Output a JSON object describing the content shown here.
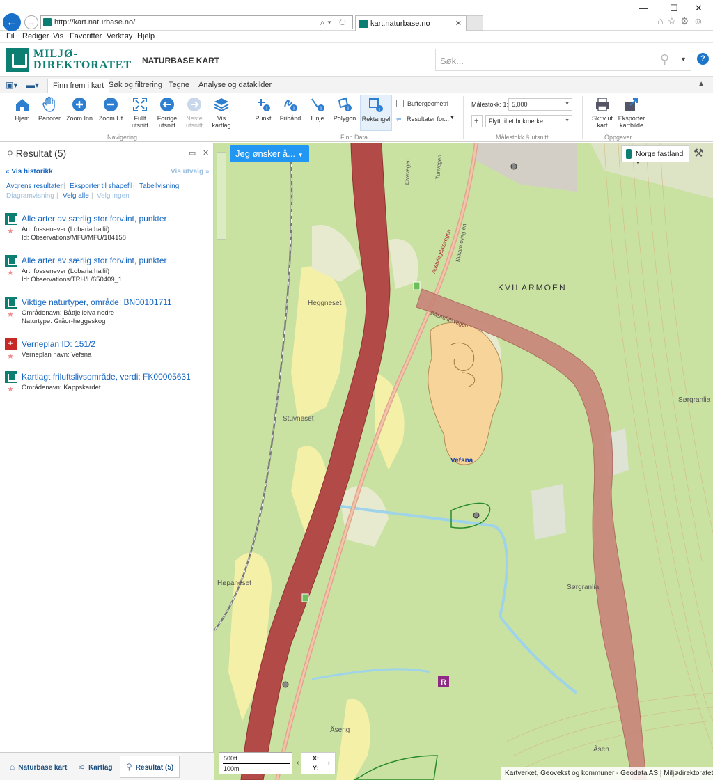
{
  "browser": {
    "url": "http://kart.naturbase.no/",
    "tab_title": "kart.naturbase.no",
    "menu": [
      "Fil",
      "Rediger",
      "Vis",
      "Favoritter",
      "Verktøy",
      "Hjelp"
    ],
    "window_controls": [
      "—",
      "☐",
      "✕"
    ]
  },
  "header": {
    "logo_line1": "MILJØ-",
    "logo_line2": "DIREKTORATET",
    "app_title": "NATURBASE KART",
    "search_placeholder": "Søk...",
    "help": "?"
  },
  "ribbon_tabs": [
    "Finn frem i kart",
    "Søk og filtrering",
    "Tegne",
    "Analyse og datakilder"
  ],
  "ribbon": {
    "nav_buttons": [
      {
        "label": "Hjem",
        "icon": "home-icon"
      },
      {
        "label": "Panorer",
        "icon": "hand-icon"
      },
      {
        "label": "Zoom Inn",
        "icon": "zoom-in-icon"
      },
      {
        "label": "Zoom Ut",
        "icon": "zoom-out-icon"
      },
      {
        "label": "Fullt utsnitt",
        "icon": "full-extent-icon"
      },
      {
        "label": "Forrige utsnitt",
        "icon": "previous-extent-icon"
      },
      {
        "label": "Neste utsnitt",
        "icon": "next-extent-icon"
      },
      {
        "label": "Vis kartlag",
        "icon": "layers-icon"
      }
    ],
    "nav_group": "Navigering",
    "data_buttons": [
      {
        "label": "Punkt",
        "icon": "point-info-icon"
      },
      {
        "label": "Frihånd",
        "icon": "freehand-info-icon"
      },
      {
        "label": "Linje",
        "icon": "line-info-icon"
      },
      {
        "label": "Polygon",
        "icon": "polygon-info-icon"
      },
      {
        "label": "Rektangel",
        "icon": "rectangle-info-icon"
      }
    ],
    "data_group": "Finn Data",
    "buffer_label": "Buffergeometri",
    "results_for": "Resultater for...",
    "scale_label": "Målestokk: 1:",
    "scale_value": "5,000",
    "bookmark_placeholder": "Flytt til et bokmerke",
    "scale_group": "Målestokk & utsnitt",
    "task_buttons": [
      {
        "label": "Skriv ut kart",
        "icon": "print-icon"
      },
      {
        "label": "Eksporter kartbilde",
        "icon": "export-icon"
      }
    ],
    "task_group": "Oppgaver"
  },
  "panel": {
    "title": "Resultat (5)",
    "vis_historikk": "Vis historikk",
    "vis_utvalg": "Vis utvalg",
    "actions": [
      "Avgrens resultater",
      "Eksporter til shapefil",
      "Tabellvisning"
    ],
    "diagram": "Diagramvisning",
    "velg_alle": "Velg alle",
    "velg_ingen": "Velg ingen",
    "results": [
      {
        "title": "Alle arter av særlig stor forv.int, punkter",
        "l1": "Art: fossenever (Lobaria hallii)",
        "l2": "Id: Observations/MFU/MFU/184158",
        "type": "naturbase"
      },
      {
        "title": "Alle arter av særlig stor forv.int, punkter",
        "l1": "Art: fossenever (Lobaria hallii)",
        "l2": "Id: Observations/TRH/L/650409_1",
        "type": "naturbase"
      },
      {
        "title": "Viktige naturtyper, område: BN00101711",
        "l1": "Områdenavn: Båtfjellelva nedre",
        "l2": "Naturtype: Gråor-heggeskog",
        "type": "naturbase"
      },
      {
        "title": "Verneplan ID: 151/2",
        "l1": "Verneplan navn: Vefsna",
        "l2": "",
        "type": "verneplan"
      },
      {
        "title": "Kartlagt friluftslivsområde, verdi: FK00005631",
        "l1": "Områdenavn: Kappskardet",
        "l2": "",
        "type": "naturbase"
      }
    ]
  },
  "bottom_tabs": [
    "Naturbase kart",
    "Kartlag",
    "Resultat (5)"
  ],
  "map": {
    "jeg_onsker": "Jeg ønsker å...",
    "basemap": "Norge fastland",
    "labels": [
      "KVILARMOEN",
      "Heggneset",
      "Stuvneset",
      "Vefsna",
      "Høpaneset",
      "Sørgranlia",
      "Sørgranlia",
      "Åseng",
      "Åsen",
      "Elvevegen",
      "Tunvegen",
      "Kvilarmoveg en",
      "Austvingdalsvegen",
      "Båsetdalsvegen"
    ],
    "scale_ft": "500ft",
    "scale_m": "100m",
    "x_label": "X:",
    "y_label": "Y:",
    "attribution": "Kartverket, Geovekst og kommuner - Geodata AS | Miljødirektoratet"
  }
}
